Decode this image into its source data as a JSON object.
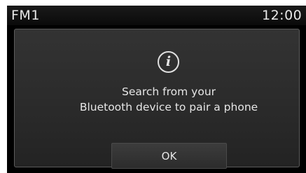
{
  "status_bar": {
    "source": "FM1",
    "time": "12:00"
  },
  "dialog": {
    "icon": "info-icon",
    "icon_glyph": "i",
    "message_line1": "Search from your",
    "message_line2": "Bluetooth device to pair a phone",
    "ok_label": "OK"
  },
  "colors": {
    "screen_background": "#000000",
    "dialog_background": "#2a2a2a",
    "text": "#e6e6e6"
  }
}
